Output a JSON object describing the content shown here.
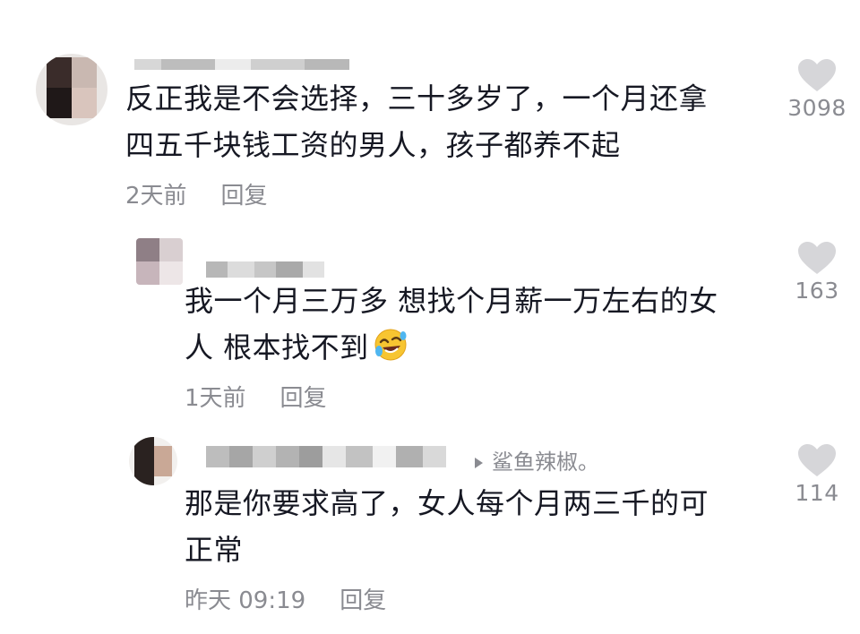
{
  "comments": [
    {
      "text_line1": "反正我是不会选择，三十多岁了，一个月还拿",
      "text_line2": "四五千块钱工资的男人，孩子都养不起",
      "time": "2天前",
      "reply_label": "回复",
      "likes": "3098"
    },
    {
      "text_line1": "我一个月三万多 想找个月薪一万左右的女",
      "text_line2": "人 根本找不到",
      "emoji": "rolling-laughing-emoji",
      "time": "1天前",
      "reply_label": "回复",
      "likes": "163"
    },
    {
      "reply_to": "鲨鱼辣椒。",
      "text_line1": "那是你要求高了，女人每个月两三千的可",
      "text_line2": "正常",
      "time": "昨天 09:19",
      "reply_label": "回复",
      "likes": "114"
    }
  ],
  "icons": {
    "like": "heart-icon",
    "reply_arrow": "triangle-right-icon"
  },
  "colors": {
    "text": "#161823",
    "meta": "#8a8b91",
    "heart": "#d6d6d9"
  }
}
